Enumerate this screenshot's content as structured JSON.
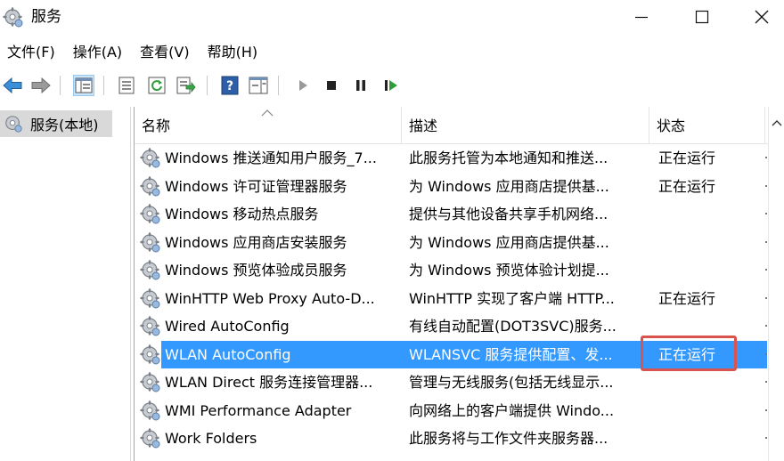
{
  "window": {
    "title": "服务",
    "icon": "gear-icon"
  },
  "menu": [
    {
      "label": "文件(F)"
    },
    {
      "label": "操作(A)"
    },
    {
      "label": "查看(V)"
    },
    {
      "label": "帮助(H)"
    }
  ],
  "toolbar": {
    "buttons": [
      "back-arrow-icon",
      "forward-arrow-icon",
      "show-hide-console-tree-icon",
      "properties-icon",
      "refresh-icon",
      "export-list-icon",
      "help-icon",
      "action-pane-icon",
      "start-service-icon",
      "stop-service-icon",
      "pause-service-icon",
      "restart-service-icon"
    ]
  },
  "tree": {
    "root_label": "服务(本地)"
  },
  "table": {
    "columns": {
      "name": "名称",
      "description": "描述",
      "status": "状态"
    },
    "rows": [
      {
        "name": "Windows 推送通知用户服务_7...",
        "description": "此服务托管为本地通知和推送...",
        "status": "正在运行"
      },
      {
        "name": "Windows 许可证管理器服务",
        "description": "为 Windows 应用商店提供基...",
        "status": "正在运行"
      },
      {
        "name": "Windows 移动热点服务",
        "description": "提供与其他设备共享手机网络...",
        "status": ""
      },
      {
        "name": "Windows 应用商店安装服务",
        "description": "为 Windows 应用商店提供基...",
        "status": ""
      },
      {
        "name": "Windows 预览体验成员服务",
        "description": "为 Windows 预览体验计划提...",
        "status": ""
      },
      {
        "name": "WinHTTP Web Proxy Auto-D...",
        "description": "WinHTTP 实现了客户端 HTTP...",
        "status": "正在运行"
      },
      {
        "name": "Wired AutoConfig",
        "description": "有线自动配置(DOT3SVC)服务...",
        "status": ""
      },
      {
        "name": "WLAN AutoConfig",
        "description": "WLANSVC 服务提供配置、发...",
        "status": "正在运行",
        "selected": true
      },
      {
        "name": "WLAN Direct 服务连接管理器...",
        "description": "管理与无线服务(包括无线显示...",
        "status": ""
      },
      {
        "name": "WMI Performance Adapter",
        "description": "向网络上的客户端提供 Windo...",
        "status": ""
      },
      {
        "name": "Work Folders",
        "description": "此服务将与工作文件夹服务器...",
        "status": ""
      }
    ]
  },
  "colors": {
    "selection": "#3399ff",
    "highlight_box": "#d9534f"
  }
}
